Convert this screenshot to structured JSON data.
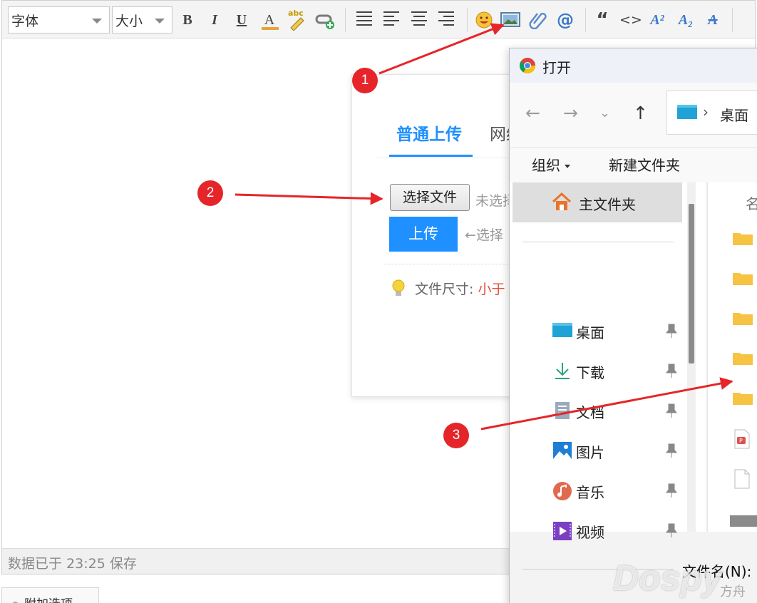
{
  "toolbar": {
    "font_select": "字体",
    "size_select": "大小",
    "bold": "B",
    "italic": "I",
    "underline": "U",
    "font_color": "A",
    "spellcheck": "abc",
    "quote": "“",
    "code": "<>",
    "superscript": "A²",
    "subscript": "A₂",
    "strikethrough": "A"
  },
  "status": {
    "saved_text": "数据已于 23:25 保存"
  },
  "addon_tab": {
    "label": "附加选项"
  },
  "upload": {
    "tab_normal": "普通上传",
    "tab_network": "网络",
    "choose_file": "选择文件",
    "no_file": "未选择",
    "upload_button": "上传",
    "select_hint": "←选择",
    "size_label": "文件尺寸: ",
    "size_value": "小于"
  },
  "dialog": {
    "title": "打开",
    "address": "桌面",
    "organize": "组织",
    "new_folder": "新建文件夹",
    "home": "主文件夹",
    "quick_access": [
      {
        "label": "桌面",
        "icon": "desktop-icon"
      },
      {
        "label": "下载",
        "icon": "download-icon"
      },
      {
        "label": "文档",
        "icon": "document-icon"
      },
      {
        "label": "图片",
        "icon": "picture-icon"
      },
      {
        "label": "音乐",
        "icon": "music-icon"
      },
      {
        "label": "视频",
        "icon": "video-icon"
      }
    ],
    "column_header": "名",
    "filename_label": "文件名(N):"
  },
  "markers": [
    "1",
    "2",
    "3"
  ],
  "watermark": {
    "main": "Dospy",
    "sub": "方舟"
  },
  "colors": {
    "accent": "#1e90ff",
    "marker": "#e5252a",
    "size_value": "#e74c3c"
  }
}
